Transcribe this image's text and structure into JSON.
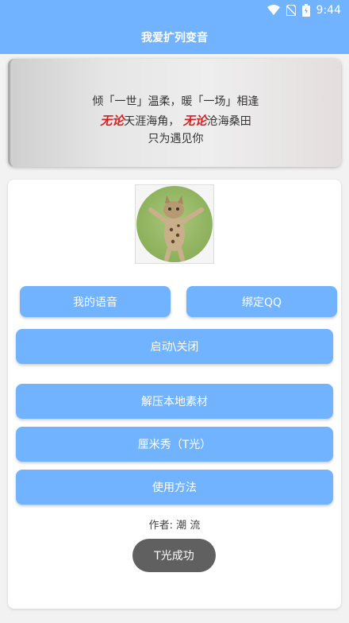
{
  "status_bar": {
    "time": "9:44"
  },
  "app_bar": {
    "title": "我爱扩列变音"
  },
  "banner": {
    "line1": "倾「一世」温柔，暖「一场」相逢",
    "line2_red1": "无论",
    "line2_a": "天涯海角，",
    "line2_red2": "无论",
    "line2_b": "沧海桑田",
    "line3": "只为遇见你"
  },
  "buttons": {
    "my_voice": "我的语音",
    "bind_qq": "绑定QQ",
    "toggle": "启动\\关闭",
    "unzip": "解压本地素材",
    "qq_show": "厘米秀（T光）",
    "usage": "使用方法"
  },
  "author": "作者: 潮 流",
  "toast": "T光成功",
  "colors": {
    "primary": "#72b3ff",
    "toast_bg": "#606060",
    "accent_red": "#d42020"
  }
}
